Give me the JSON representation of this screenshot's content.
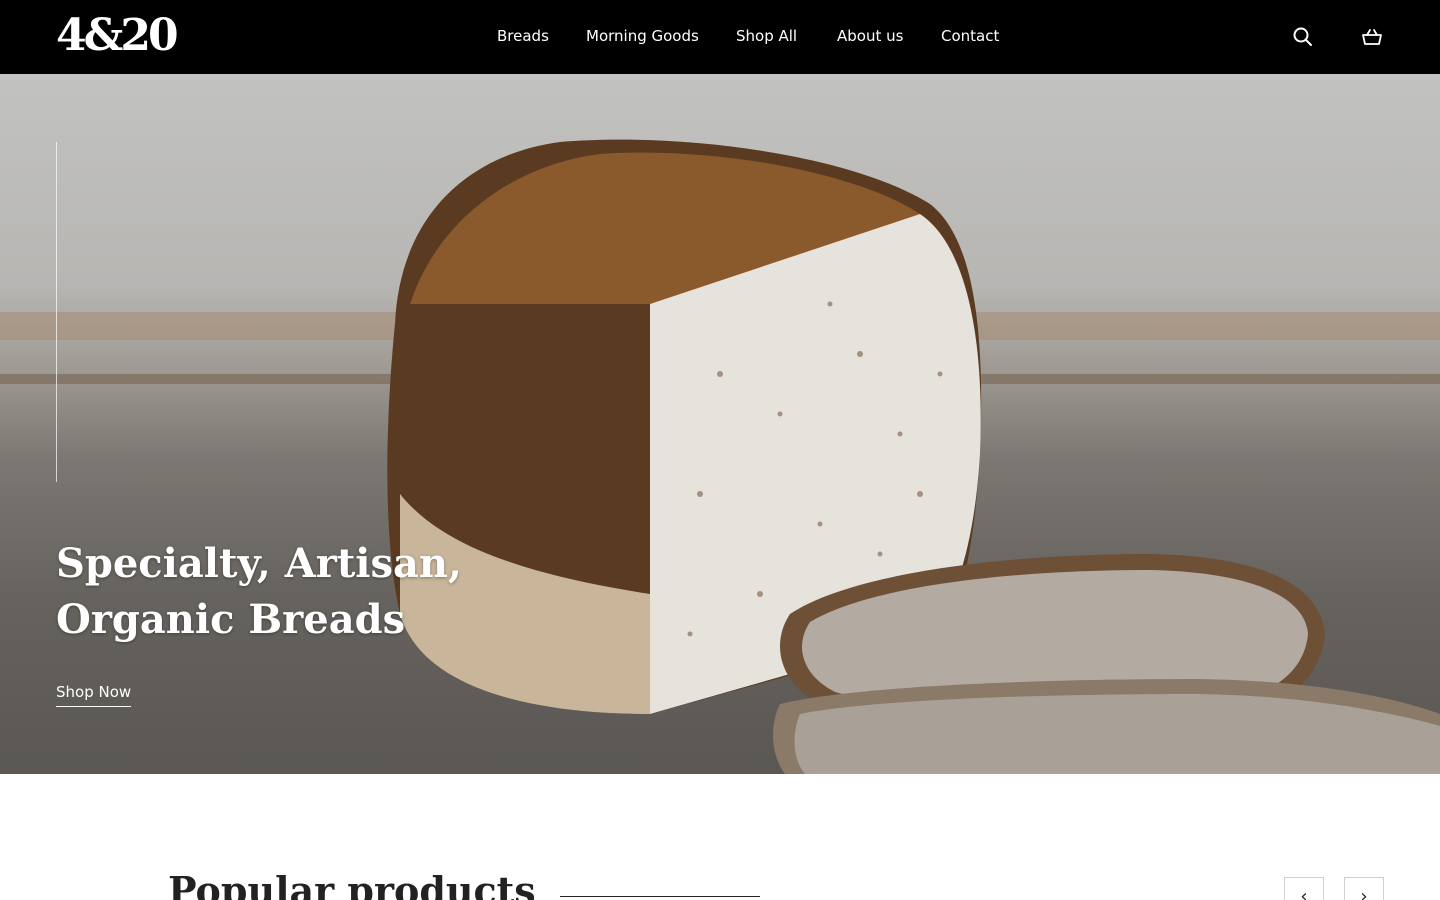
{
  "header": {
    "logo": "4&20",
    "nav": [
      "Breads",
      "Morning Goods",
      "Shop All",
      "About us",
      "Contact"
    ],
    "icons": {
      "search": "search-icon",
      "cart": "cart-icon"
    }
  },
  "hero": {
    "title": "Specialty, Artisan, Organic Breads",
    "cta": "Shop Now"
  },
  "popular": {
    "title": "Popular products",
    "prev": "‹",
    "next": "›"
  }
}
